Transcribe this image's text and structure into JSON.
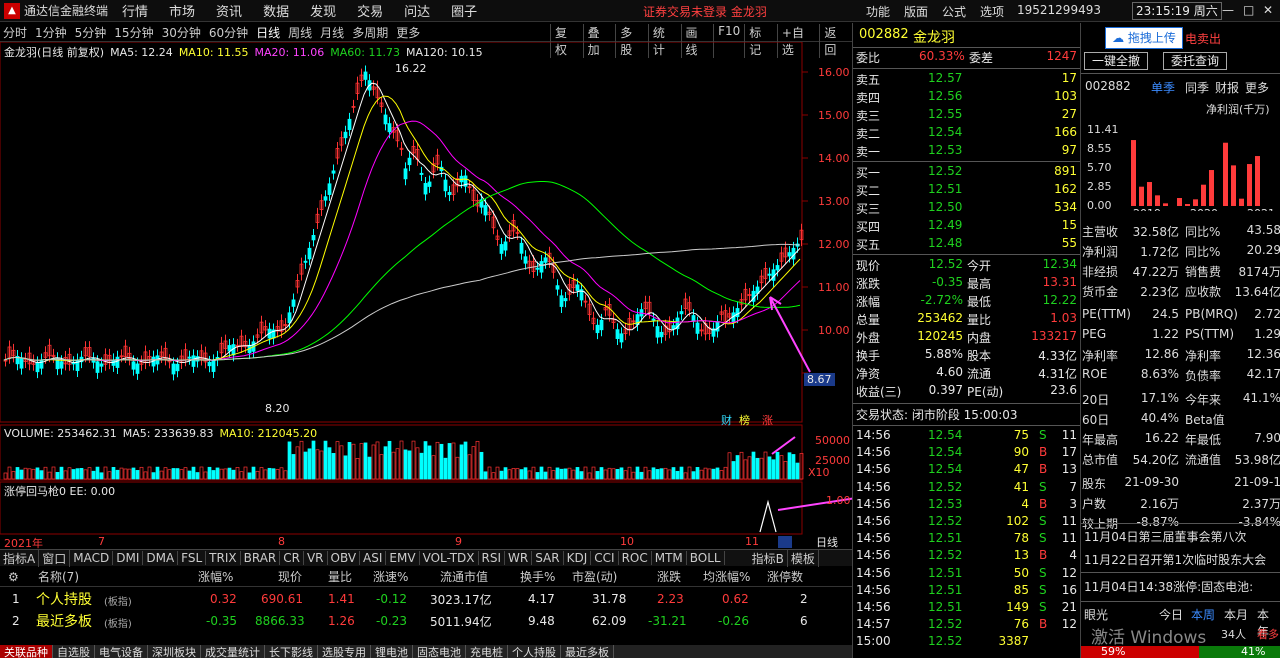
{
  "titlebar": {
    "app_title": "通达信金融终端",
    "menus": [
      "行情",
      "市场",
      "资讯",
      "数据",
      "发现",
      "交易",
      "问达",
      "圈子"
    ],
    "login_warning": "证券交易未登录  金龙羽",
    "right_menus": [
      "功能",
      "版面",
      "公式",
      "选项"
    ],
    "phone": "19521299493",
    "clock": "23:15:19 周六",
    "win_min": "—",
    "win_max": "□",
    "win_close": "✕"
  },
  "toolbar": {
    "periods": [
      "分时",
      "1分钟",
      "5分钟",
      "15分钟",
      "30分钟",
      "60分钟",
      "日线",
      "周线",
      "月线",
      "多周期",
      "更多"
    ],
    "active": "日线",
    "tools": [
      "复权",
      "叠加",
      "多股",
      "统计",
      "画线",
      "F10",
      "标记",
      "+自选",
      "返回"
    ]
  },
  "chart": {
    "legend_name": "金龙羽(日线 前复权)",
    "ma5": "MA5: 12.24",
    "ma10": "MA10: 11.55",
    "ma20": "MA20: 11.06",
    "ma60": "MA60: 11.73",
    "ma120": "MA120: 10.15",
    "high_label": "16.22",
    "low_label": "8.20",
    "current_price_tag": "8.67",
    "y_ticks": [
      "16.00",
      "15.00",
      "14.00",
      "13.00",
      "12.00",
      "11.00",
      "10.00",
      "9.00"
    ],
    "badges": [
      "财",
      "榜",
      "涨"
    ],
    "colors": {
      "ma5": "#ffffff",
      "ma10": "#ffff00",
      "ma20": "#ff00ff",
      "ma60": "#00ff00",
      "ma120": "#cccccc",
      "up": "#ff3333",
      "down": "#00ffff"
    }
  },
  "volume": {
    "legend_name": "VOLUME: 253462.31",
    "ma5": "MA5: 233639.83",
    "ma10": "MA10: 212045.20",
    "y_ticks": [
      "50000",
      "25000",
      "X10"
    ]
  },
  "ztb": {
    "legend_name": "涨停回马枪0 EE: 0.00",
    "y_tick": "1.00"
  },
  "timeaxis": {
    "labels": [
      "2021年",
      "7",
      "8",
      "9",
      "10",
      "11"
    ],
    "period_btn": "日线"
  },
  "indicators": [
    "指标A",
    "窗口",
    "MACD",
    "DMI",
    "DMA",
    "FSL",
    "TRIX",
    "BRAR",
    "CR",
    "VR",
    "OBV",
    "ASI",
    "EMV",
    "VOL-TDX",
    "RSI",
    "WR",
    "SAR",
    "KDJ",
    "CCI",
    "ROC",
    "MTM",
    "BOLL"
  ],
  "indicator_b": "指标B",
  "template": "模板",
  "table": {
    "headers": [
      "名称(7)",
      "涨幅%",
      "现价",
      "量比",
      "涨速%",
      "流通市值",
      "换手%",
      "市盈(动)",
      "涨跌",
      "均涨幅%",
      "涨停数"
    ],
    "rows": [
      {
        "idx": "1",
        "name": "个人持股",
        "tag": "(板指)",
        "chg": "0.32",
        "price": "690.61",
        "vr": "1.41",
        "speed": "-0.12",
        "mcap": "3023.17亿",
        "turn": "4.17",
        "pe": "31.78",
        "diff": "2.23",
        "avg": "0.62",
        "zt": "2"
      },
      {
        "idx": "2",
        "name": "最近多板",
        "tag": "(板指)",
        "chg": "-0.35",
        "price": "8866.33",
        "vr": "1.26",
        "speed": "-0.23",
        "mcap": "5011.94亿",
        "turn": "9.48",
        "pe": "62.09",
        "diff": "-31.21",
        "avg": "-0.26",
        "zt": "6"
      }
    ]
  },
  "bottom_tabs": [
    "关联品种",
    "自选股",
    "电气设备",
    "深圳板块",
    "成交量统计",
    "长下影线",
    "选股专用",
    "锂电池",
    "固态电池",
    "充电桩",
    "个人持股",
    "最近多板"
  ],
  "quote": {
    "code": "002882",
    "name": "金龙羽",
    "webi_label": "委比",
    "webi": "60.33%",
    "wecha_label": "委差",
    "wecha": "1247",
    "asks": [
      {
        "label": "卖五",
        "price": "12.57",
        "vol": "17"
      },
      {
        "label": "卖四",
        "price": "12.56",
        "vol": "103"
      },
      {
        "label": "卖三",
        "price": "12.55",
        "vol": "27"
      },
      {
        "label": "卖二",
        "price": "12.54",
        "vol": "166"
      },
      {
        "label": "卖一",
        "price": "12.53",
        "vol": "97"
      }
    ],
    "bids": [
      {
        "label": "买一",
        "price": "12.52",
        "vol": "891"
      },
      {
        "label": "买二",
        "price": "12.51",
        "vol": "162"
      },
      {
        "label": "买三",
        "price": "12.50",
        "vol": "534"
      },
      {
        "label": "买四",
        "price": "12.49",
        "vol": "15"
      },
      {
        "label": "买五",
        "price": "12.48",
        "vol": "55"
      }
    ],
    "stats": [
      [
        "现价",
        "12.52",
        "今开",
        "12.34"
      ],
      [
        "涨跌",
        "-0.35",
        "最高",
        "13.31"
      ],
      [
        "涨幅",
        "-2.72%",
        "最低",
        "12.22"
      ],
      [
        "总量",
        "253462",
        "量比",
        "1.03"
      ],
      [
        "外盘",
        "120245",
        "内盘",
        "133217"
      ],
      [
        "换手",
        "5.88%",
        "股本",
        "4.33亿"
      ],
      [
        "净资",
        "4.60",
        "流通",
        "4.31亿"
      ],
      [
        "收益(三)",
        "0.397",
        "PE(动)",
        "23.6"
      ]
    ],
    "status": "交易状态: 闭市阶段 15:00:03",
    "ticks": [
      [
        "14:56",
        "12.54",
        "75",
        "S",
        "11"
      ],
      [
        "14:56",
        "12.54",
        "90",
        "B",
        "17"
      ],
      [
        "14:56",
        "12.54",
        "47",
        "B",
        "13"
      ],
      [
        "14:56",
        "12.52",
        "41",
        "S",
        "7"
      ],
      [
        "14:56",
        "12.53",
        "4",
        "B",
        "3"
      ],
      [
        "14:56",
        "12.52",
        "102",
        "S",
        "11"
      ],
      [
        "14:56",
        "12.51",
        "78",
        "S",
        "11"
      ],
      [
        "14:56",
        "12.52",
        "13",
        "B",
        "4"
      ],
      [
        "14:56",
        "12.51",
        "50",
        "S",
        "12"
      ],
      [
        "14:56",
        "12.51",
        "85",
        "S",
        "16"
      ],
      [
        "14:56",
        "12.51",
        "149",
        "S",
        "21"
      ],
      [
        "14:57",
        "12.52",
        "76",
        "B",
        "12"
      ],
      [
        "15:00",
        "12.52",
        "3387",
        "",
        ""
      ]
    ]
  },
  "right": {
    "upload_btn": "拖拽上传",
    "sell_btn": "电卖出",
    "cancel_all": "一键全撤",
    "commission": "委托查询",
    "code": "002882",
    "tabs": [
      "单季",
      "同季",
      "财报",
      "更多"
    ],
    "unit": "净利润(千万)",
    "yvals": [
      "11.41",
      "8.55",
      "5.70",
      "2.85",
      "0.00"
    ],
    "years": [
      "2019",
      "2020",
      "2021"
    ],
    "bars": [
      9.9,
      2.9,
      3.6,
      1.6,
      0.4,
      1.2,
      0.3,
      1.0,
      3.2,
      5.4,
      9.5,
      6.1,
      1.1,
      6.3,
      7.5
    ],
    "fin": [
      [
        "主营收",
        "32.58亿",
        "同比%",
        "43.58"
      ],
      [
        "净利润",
        "1.72亿",
        "同比%",
        "20.29"
      ],
      [
        "非经损",
        "47.22万",
        "销售费",
        "8174万"
      ],
      [
        "货币金",
        "2.23亿",
        "应收款",
        "13.64亿"
      ],
      [
        "PE(TTM)",
        "24.5",
        "PB(MRQ)",
        "2.72"
      ],
      [
        "PEG",
        "1.22",
        "PS(TTM)",
        "1.29"
      ],
      [
        "净利率",
        "12.86",
        "净利率",
        "12.36"
      ],
      [
        "ROE",
        "8.63%",
        "负债率",
        "42.17"
      ],
      [
        "20日",
        "17.1%",
        "今年来",
        "41.1%"
      ],
      [
        "60日",
        "40.4%",
        "Beta值",
        ""
      ],
      [
        "年最高",
        "16.22",
        "年最低",
        "7.90"
      ],
      [
        "总市值",
        "54.20亿",
        "流通值",
        "53.98亿"
      ],
      [
        "股东",
        "21-09-30",
        "",
        "21-09-1"
      ],
      [
        "户数",
        "2.16万",
        "",
        "2.37万"
      ],
      [
        "较上期",
        "-8.87%",
        "",
        "-3.84%"
      ]
    ],
    "news": [
      "11月04日第三届董事会第八次",
      "11月22日召开第1次临时股东大会",
      "11月04日14:38涨停:固态电池:"
    ],
    "foot": [
      "眼光",
      "今日",
      "本周",
      "本月",
      "本年"
    ],
    "foot2": "34人",
    "foot3": "看多",
    "pct1": "59%",
    "pct2": "41%",
    "watermark": "激活 Windows"
  }
}
